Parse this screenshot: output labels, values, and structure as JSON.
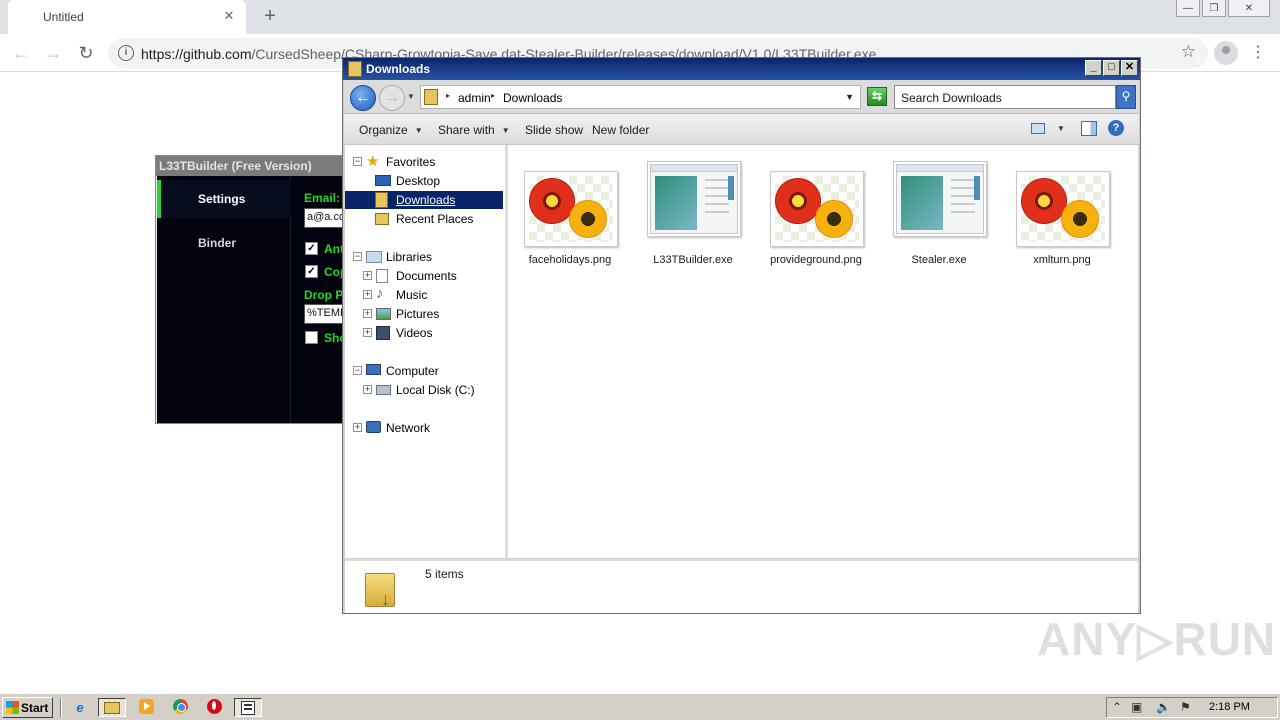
{
  "browser": {
    "tab_title": "Untitled",
    "tab_close": "✕",
    "new_tab": "+",
    "url_host": "https://github.com",
    "url_path": "/CursedSheep/CSharp-Growtopia-Save.dat-Stealer-Builder/releases/download/V1.0/L33TBuilder.exe",
    "window_controls": [
      "—",
      "❐",
      "✕"
    ]
  },
  "builder": {
    "title": "L33TBuilder (Free Version)",
    "sidebar": [
      {
        "label": "Settings",
        "active": true
      },
      {
        "label": "Binder",
        "active": false
      }
    ],
    "email_label": "Email:",
    "email_value": "a@a.co",
    "check1_label": "Anti",
    "check1_checked": true,
    "check2_label": "Copy",
    "check2_checked": true,
    "drop_label": "Drop P",
    "drop_value": "%TEMP",
    "check3_label": "Sho",
    "check3_checked": false
  },
  "explorer": {
    "title": "Downloads",
    "breadcrumb": [
      "admin",
      "Downloads"
    ],
    "search_placeholder": "Search Downloads",
    "commands": [
      "Organize",
      "Share with",
      "Slide show",
      "New folder"
    ],
    "nav": {
      "favorites": "Favorites",
      "desktop": "Desktop",
      "downloads": "Downloads",
      "recent": "Recent Places",
      "libraries": "Libraries",
      "documents": "Documents",
      "music": "Music",
      "pictures": "Pictures",
      "videos": "Videos",
      "computer": "Computer",
      "local_disk": "Local Disk (C:)",
      "network": "Network"
    },
    "files": [
      {
        "name": "faceholidays.png",
        "kind": "image"
      },
      {
        "name": "L33TBuilder.exe",
        "kind": "exe"
      },
      {
        "name": "provideground.png",
        "kind": "image"
      },
      {
        "name": "Stealer.exe",
        "kind": "exe"
      },
      {
        "name": "xmlturn.png",
        "kind": "image"
      }
    ],
    "status": "5 items"
  },
  "watermark": "ANY▷RUN",
  "taskbar": {
    "start_label": "Start",
    "clock": "2:18 PM"
  },
  "colors": {
    "titlebar": "#0a246a",
    "builder_accent": "#1edb1e",
    "selection": "#0a246a"
  }
}
